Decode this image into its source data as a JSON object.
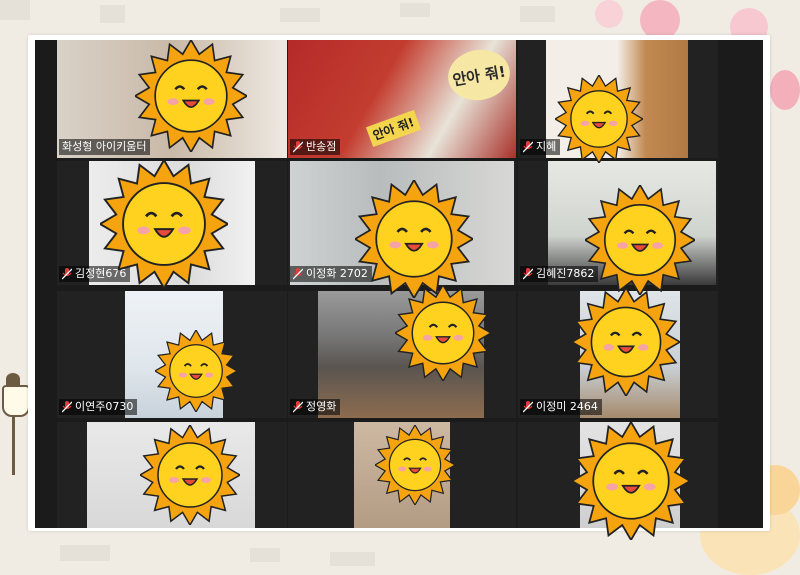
{
  "colors": {
    "background": "#f1ece3",
    "grid": "#1b1b1b",
    "active_speaker_border": "#d8f05a",
    "mute_icon": "#e23b3b",
    "sun_fill": "#ffd21f",
    "sun_rays": "#f5a40f"
  },
  "gallery": {
    "tiles": [
      {
        "name": "화성형 아이키움터",
        "muted": false,
        "active": true
      },
      {
        "name": "반송점",
        "muted": true,
        "active": false
      },
      {
        "name": "지혜",
        "muted": true,
        "active": false
      },
      {
        "name": "김정현676",
        "muted": true,
        "active": false
      },
      {
        "name": "이정화 2702",
        "muted": true,
        "active": false
      },
      {
        "name": "김혜진7862",
        "muted": true,
        "active": false
      },
      {
        "name": "이연주0730",
        "muted": true,
        "active": false
      },
      {
        "name": "정영화",
        "muted": true,
        "active": false
      },
      {
        "name": "이정미 2464",
        "muted": true,
        "active": false
      },
      {
        "name": "",
        "muted": false,
        "active": false
      },
      {
        "name": "",
        "muted": false,
        "active": false
      },
      {
        "name": "",
        "muted": false,
        "active": false
      }
    ]
  },
  "poster_text": {
    "line1": "안아 줘!",
    "line2": "안아 줘!"
  },
  "icons": {
    "mute": "microphone-muted-icon",
    "sticker": "smiling-sun-sticker-icon",
    "lamp": "street-lamp-icon"
  }
}
